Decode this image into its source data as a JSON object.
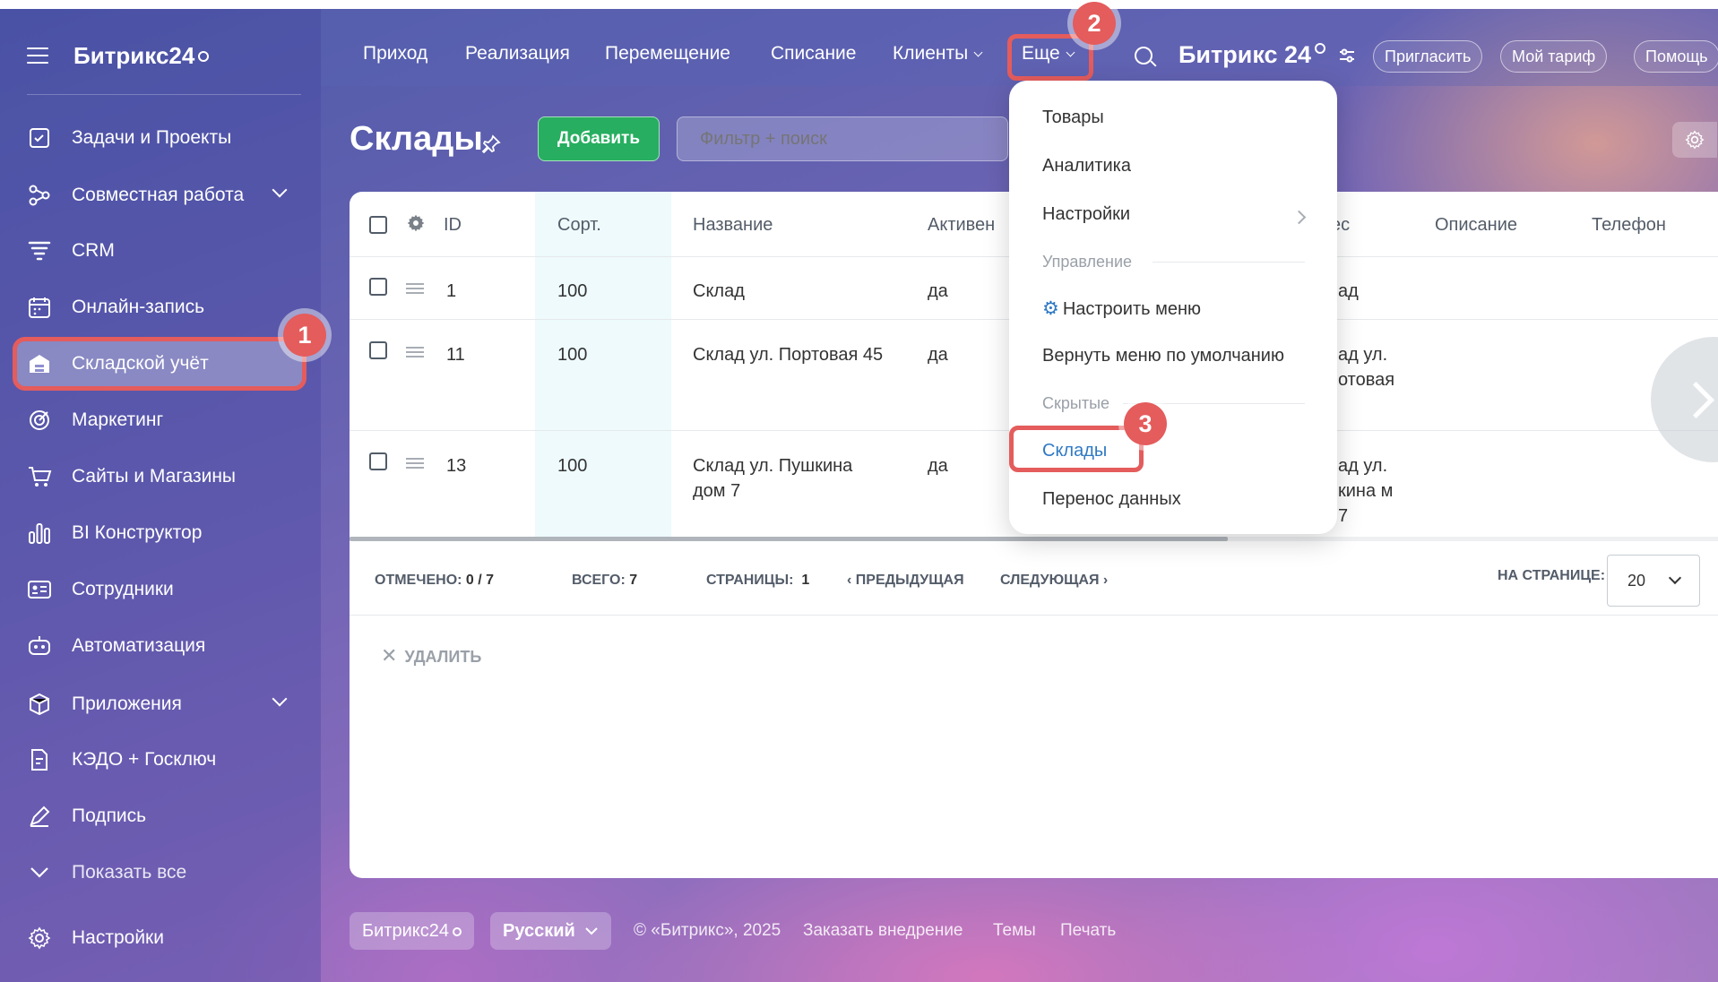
{
  "sidebar": {
    "logo": "Битрикс24",
    "items": [
      {
        "label": "Задачи и Проекты",
        "icon": "checkbox-icon"
      },
      {
        "label": "Совместная работа",
        "icon": "collab-icon"
      },
      {
        "label": "CRM",
        "icon": "crm-icon"
      },
      {
        "label": "Онлайн-запись",
        "icon": "calendar-icon"
      },
      {
        "label": "Складской учёт",
        "icon": "warehouse-icon"
      },
      {
        "label": "Маркетинг",
        "icon": "target-icon"
      },
      {
        "label": "Сайты и Магазины",
        "icon": "cart-icon"
      },
      {
        "label": "BI Конструктор",
        "icon": "bar-chart-icon"
      },
      {
        "label": "Сотрудники",
        "icon": "id-card-icon"
      },
      {
        "label": "Автоматизация",
        "icon": "robot-icon"
      },
      {
        "label": "Приложения",
        "icon": "box-icon"
      },
      {
        "label": "КЭДО + Госключ",
        "icon": "document-icon"
      },
      {
        "label": "Подпись",
        "icon": "pen-icon"
      },
      {
        "label": "Показать все",
        "icon": "chevron-down-icon"
      },
      {
        "label": "Настройки",
        "icon": "gear-icon"
      }
    ]
  },
  "topnav": {
    "items": [
      "Приход",
      "Реализация",
      "Перемещение",
      "Списание",
      "Клиенты",
      "Еще"
    ],
    "brand": "Битрикс 24",
    "invite": "Пригласить",
    "tariff": "Мой тариф",
    "help": "Помощь"
  },
  "badges": [
    "1",
    "2",
    "3"
  ],
  "page": {
    "title": "Склады",
    "add_button": "Добавить",
    "filter_placeholder": "Фильтр + поиск"
  },
  "grid": {
    "columns": [
      "ID",
      "Сорт.",
      "Название",
      "Активен",
      "ес",
      "Описание",
      "Телефон"
    ],
    "rows": [
      {
        "id": "1",
        "sort": "100",
        "name": "Склад",
        "active": "да",
        "addr": "ад"
      },
      {
        "id": "11",
        "sort": "100",
        "name": "Склад ул. Портовая 45",
        "active": "да",
        "addr": "ад ул. отовая"
      },
      {
        "id": "13",
        "sort": "100",
        "name": "Склад ул. Пушкина дом 7",
        "active": "да",
        "addr": "ад ул. кина м 7"
      }
    ],
    "footer": {
      "marked_label": "ОТМЕЧЕНО:",
      "marked_value": "0 / 7",
      "total_label": "ВСЕГО:",
      "total_value": "7",
      "pages_label": "СТРАНИЦЫ:",
      "pages_value": "1",
      "prev": "ПРЕДЫДУЩАЯ",
      "next": "СЛЕДУЮЩАЯ",
      "per_page_label": "НА СТРАНИЦЕ:",
      "per_page_value": "20"
    },
    "delete": "УДАЛИТЬ"
  },
  "menu": {
    "items": [
      "Товары",
      "Аналитика",
      "Настройки"
    ],
    "section_manage": "Управление",
    "configure": "Настроить меню",
    "reset": "Вернуть меню по умолчанию",
    "section_hidden": "Скрытые",
    "hidden_items": [
      "Склады",
      "Перенос данных"
    ]
  },
  "bottom": {
    "brand": "Битрикс24",
    "language": "Русский",
    "copyright": "© «Битрикс», 2025",
    "order": "Заказать внедрение",
    "themes": "Темы",
    "print": "Печать"
  },
  "colors": {
    "highlight": "#e45c5c",
    "add_button": "#27ae60",
    "link_blue": "#2f79c3"
  }
}
